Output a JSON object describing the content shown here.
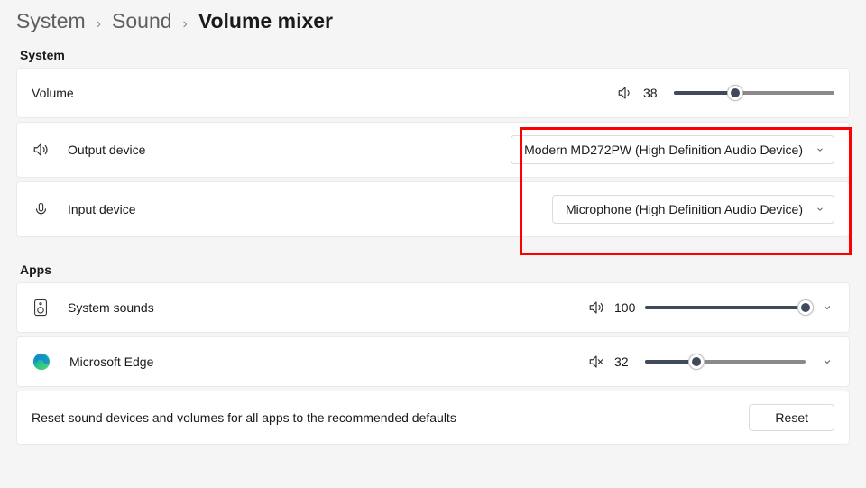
{
  "breadcrumb": {
    "root": "System",
    "mid": "Sound",
    "current": "Volume mixer"
  },
  "sections": {
    "system": "System",
    "apps": "Apps"
  },
  "volume": {
    "label": "Volume",
    "value": 38
  },
  "output": {
    "label": "Output device",
    "selected": "Modern MD272PW (High Definition Audio Device)"
  },
  "input": {
    "label": "Input device",
    "selected": "Microphone (High Definition Audio Device)"
  },
  "apps": {
    "system_sounds": {
      "label": "System sounds",
      "value": 100
    },
    "edge": {
      "label": "Microsoft Edge",
      "value": 32
    }
  },
  "reset": {
    "label": "Reset sound devices and volumes for all apps to the recommended defaults",
    "button": "Reset"
  }
}
